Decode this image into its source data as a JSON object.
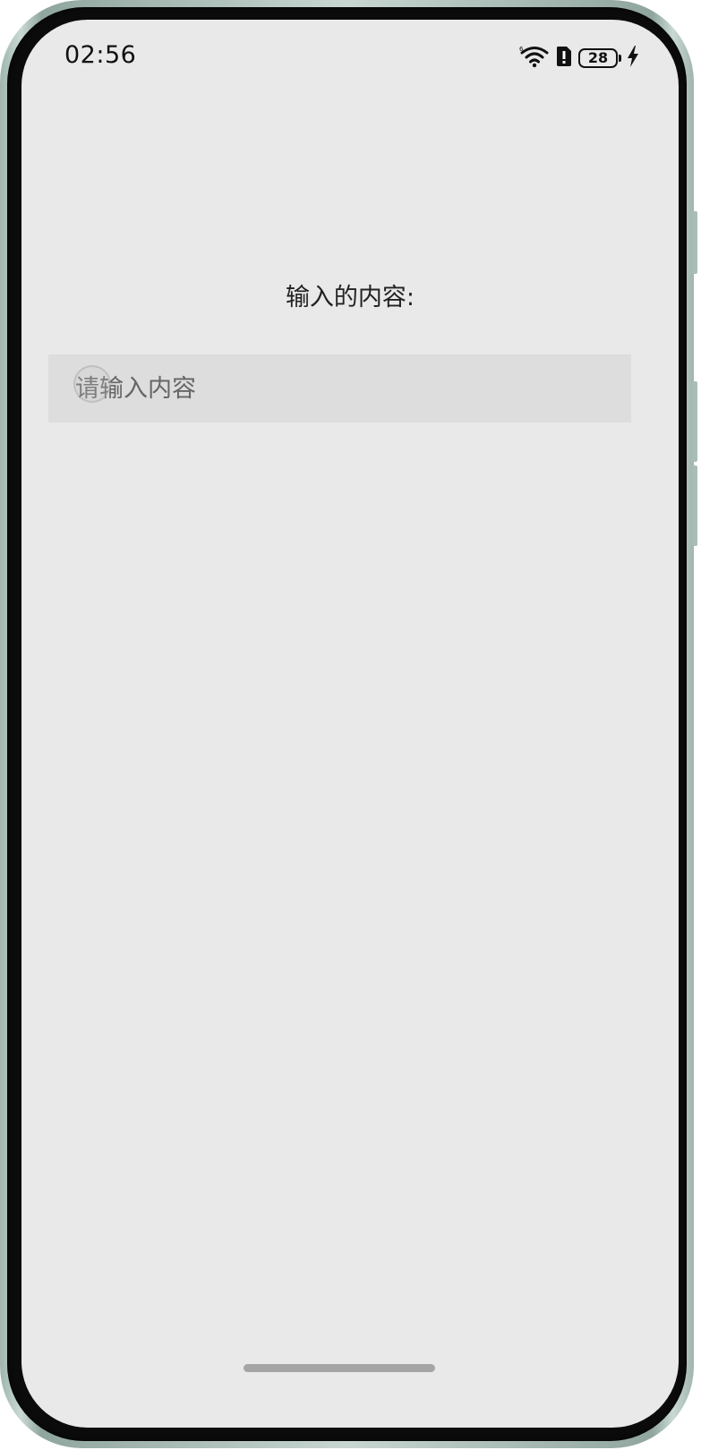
{
  "status_bar": {
    "time": "02:56",
    "battery_level": "28",
    "icons": [
      "wifi-icon",
      "alert-icon",
      "battery-icon",
      "charging-icon"
    ]
  },
  "main": {
    "label": "输入的内容:",
    "input": {
      "value": "",
      "placeholder": "请输入内容"
    }
  }
}
